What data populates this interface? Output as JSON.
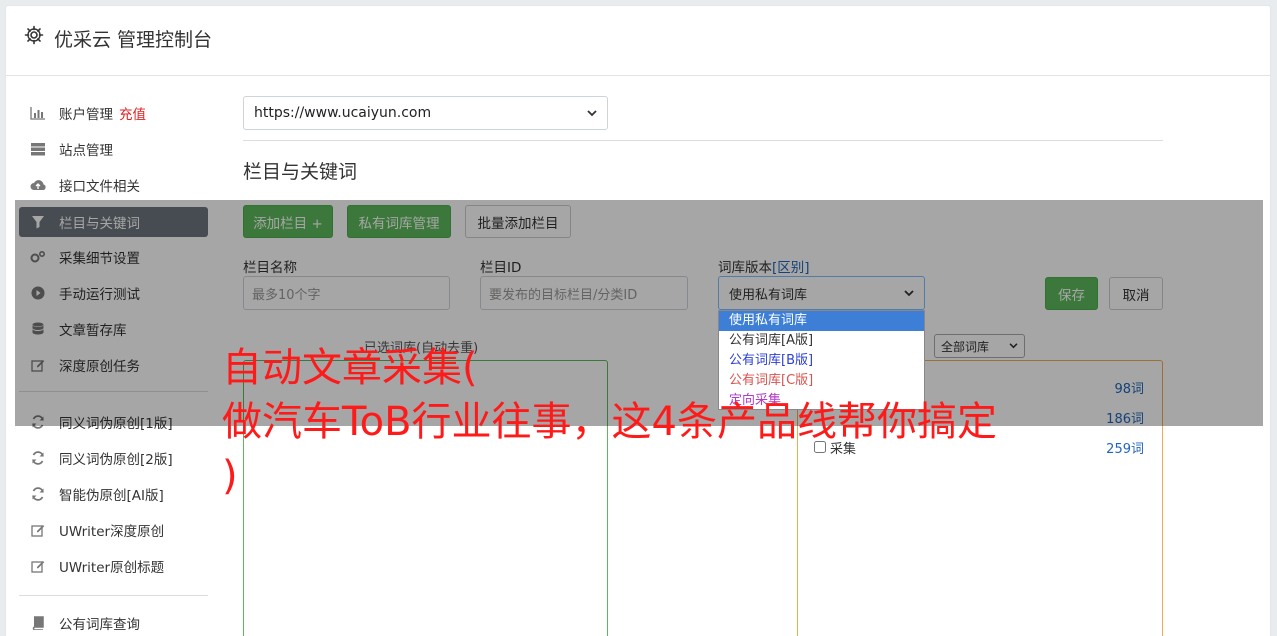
{
  "header": {
    "title": "优采云 管理控制台",
    "icon": "gear-icon"
  },
  "sidebar": {
    "items": [
      {
        "label": "账户管理",
        "badge": "充值",
        "icon": "bar-chart-icon"
      },
      {
        "label": "站点管理",
        "icon": "server-icon"
      },
      {
        "label": "接口文件相关",
        "icon": "cloud-upload-icon"
      },
      {
        "label": "栏目与关键词",
        "icon": "filter-icon",
        "active": true
      },
      {
        "label": "采集细节设置",
        "icon": "gears-icon"
      },
      {
        "label": "手动运行测试",
        "icon": "play-circle-icon"
      },
      {
        "label": "文章暂存库",
        "icon": "database-icon"
      },
      {
        "label": "深度原创任务",
        "icon": "edit-icon"
      },
      {
        "label": "同义词伪原创[1版]",
        "icon": "refresh-icon"
      },
      {
        "label": "同义词伪原创[2版]",
        "icon": "refresh-icon"
      },
      {
        "label": "智能伪原创[AI版]",
        "icon": "refresh-icon"
      },
      {
        "label": "UWriter深度原创",
        "icon": "edit-icon"
      },
      {
        "label": "UWriter原创标题",
        "icon": "edit-icon"
      },
      {
        "label": "公有词库查询",
        "icon": "book-icon"
      }
    ]
  },
  "main": {
    "site_select": "https://www.ucaiyun.com",
    "section_title": "栏目与关键词",
    "buttons": {
      "add_column": "添加栏目 +",
      "private_lib": "私有词库管理",
      "batch_add": "批量添加栏目",
      "save": "保存",
      "cancel": "取消"
    },
    "fields": {
      "column_name_label": "栏目名称",
      "column_name_placeholder": "最多10个字",
      "column_id_label": "栏目ID",
      "column_id_placeholder": "要发布的目标栏目/分类ID",
      "lib_version_label": "词库版本",
      "lib_version_link": "[区别]",
      "lib_version_value": "使用私有词库"
    },
    "dropdown_options": [
      "使用私有词库",
      "公有词库[A版]",
      "公有词库[B版]",
      "公有词库[C版]",
      "定向采集"
    ],
    "list_caption": "已选词库(自动去重)",
    "filter_select": "全部词库",
    "libraries": [
      {
        "name": "",
        "count": "98词"
      },
      {
        "name": "",
        "count": "186词"
      },
      {
        "name": "采集",
        "count": "259词"
      }
    ]
  },
  "watermark": {
    "line1": "自动文章采集(",
    "line2": "做汽车ToB行业往事，这4条产品线帮你搞定",
    "line3": ")"
  },
  "colors": {
    "accent_green": "#5cb85c",
    "active_nav": "#6c757d",
    "link_blue": "#2266bb",
    "watermark_red": "#ff1a1a"
  }
}
